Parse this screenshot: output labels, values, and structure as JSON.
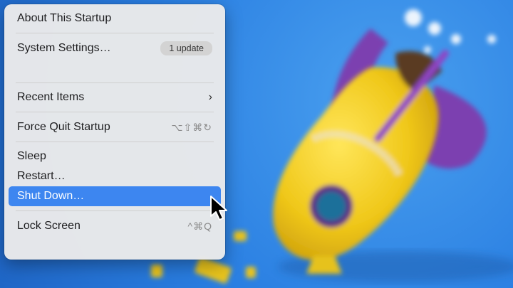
{
  "menu": {
    "about": "About This Startup",
    "system_settings": "System Settings…",
    "update_badge": "1 update",
    "recent_items": "Recent Items",
    "recent_chevron": "›",
    "force_quit": "Force Quit Startup",
    "force_quit_shortcut": "⌥⇧⌘↻",
    "sleep": "Sleep",
    "restart": "Restart…",
    "shut_down": "Shut Down…",
    "lock_screen": "Lock Screen",
    "lock_shortcut": "^⌘Q"
  },
  "colors": {
    "highlight": "#3d86f0",
    "wallpaper_blue": "#2a7fe2",
    "rocket_yellow": "#f2d21c",
    "fin_purple": "#7b3fb0"
  },
  "icons": [
    "chevron-right-icon",
    "pointer-cursor-icon"
  ]
}
